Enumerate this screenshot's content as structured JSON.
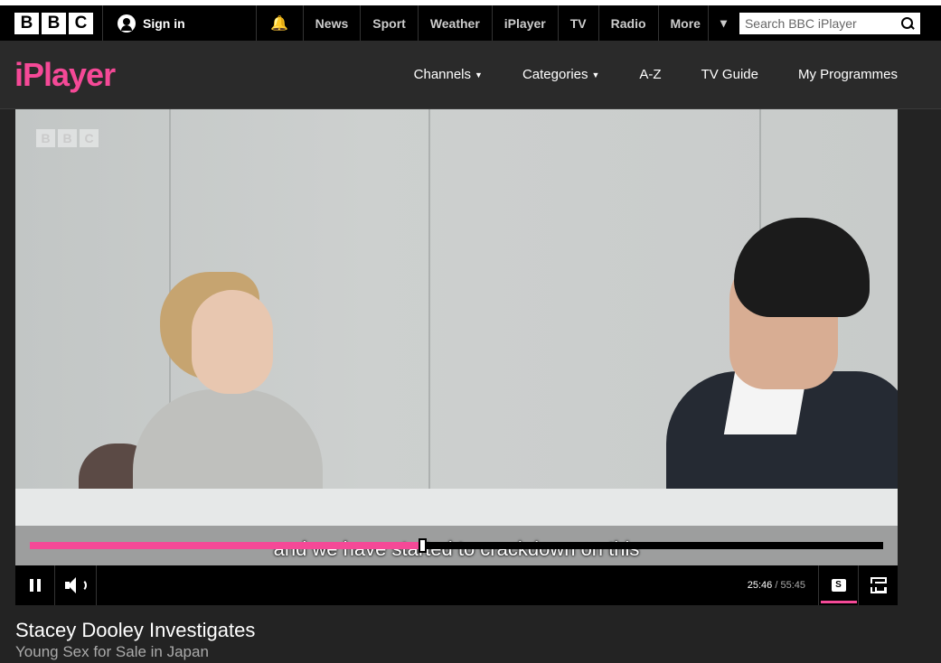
{
  "bbc_logo": [
    "B",
    "B",
    "C"
  ],
  "header": {
    "signin_label": "Sign in",
    "nav": [
      "News",
      "Sport",
      "Weather",
      "iPlayer",
      "TV",
      "Radio",
      "More"
    ],
    "search_placeholder": "Search BBC iPlayer"
  },
  "iplayer": {
    "logo": "iPlayer",
    "menu": [
      "Channels",
      "Categories",
      "A-Z",
      "TV Guide",
      "My Programmes"
    ]
  },
  "player": {
    "watermark": [
      "B",
      "B",
      "C"
    ],
    "subtitle": "and we have started to crackdown on this",
    "progress_fraction": 0.46,
    "current_time": "25:46",
    "total_time": "/ 55:45",
    "subtitles_label": "S"
  },
  "programme": {
    "title": "Stacey Dooley Investigates",
    "episode": "Young Sex for Sale in Japan"
  },
  "colors": {
    "accent": "#f54997",
    "background": "#232323"
  }
}
